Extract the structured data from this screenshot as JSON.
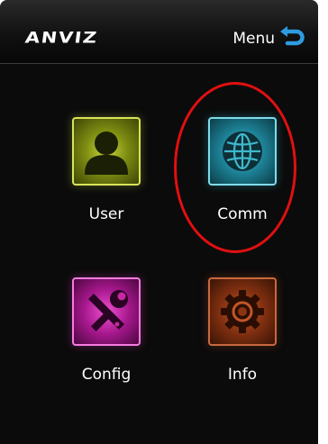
{
  "header": {
    "brand": "ANVIZ",
    "title": "Menu",
    "back_icon": "return-arrow-icon"
  },
  "menu": {
    "items": [
      {
        "label": "User",
        "icon": "user-silhouette-icon",
        "color": "#a4b31f"
      },
      {
        "label": "Comm",
        "icon": "globe-icon",
        "color": "#2aa6bd"
      },
      {
        "label": "Config",
        "icon": "tools-icon",
        "color": "#d12fb5"
      },
      {
        "label": "Info",
        "icon": "gear-icon",
        "color": "#a4431b"
      }
    ]
  },
  "annotation": {
    "type": "red-circle-highlight",
    "target": "Comm",
    "color": "#e01010"
  },
  "colors": {
    "background": "#0b0b0b",
    "text": "#ffffff",
    "accent_back": "#2e9be0"
  }
}
